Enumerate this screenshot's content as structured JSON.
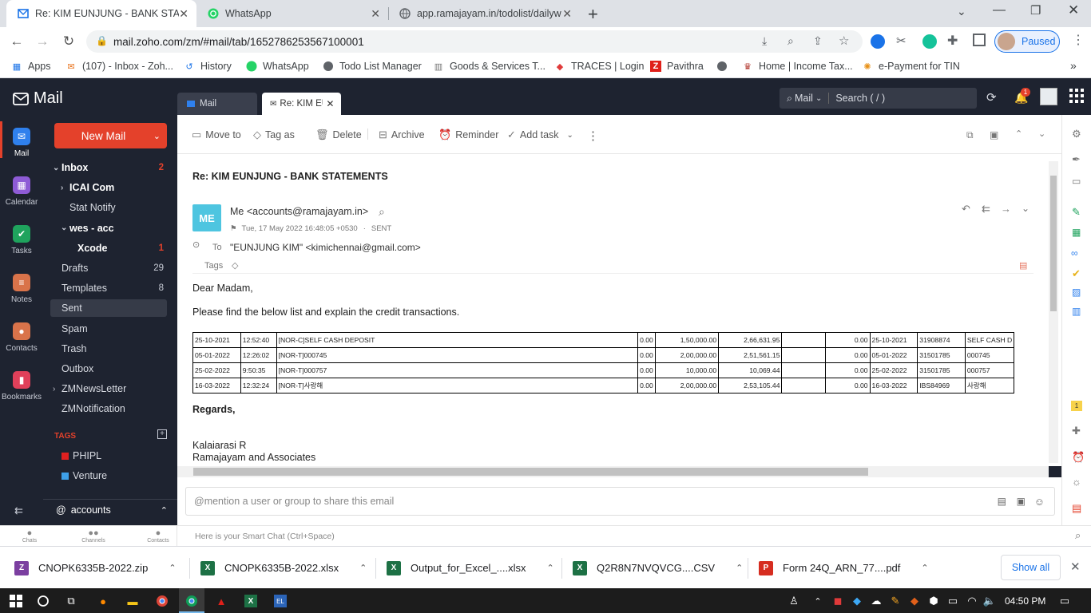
{
  "browser": {
    "tabs": [
      {
        "title": "Re: KIM EUNJUNG - BANK STATE",
        "active": true
      },
      {
        "title": "WhatsApp",
        "active": false
      },
      {
        "title": "app.ramajayam.in/todolist/dailyw",
        "active": false
      }
    ],
    "new_tab": "+",
    "url": "mail.zoho.com/zm/#mail/tab/1652786253567100001",
    "profile_status": "Paused",
    "bookmarks": [
      "Apps",
      "(107) - Inbox - Zoh...",
      "History",
      "WhatsApp",
      "Todo List Manager",
      "Goods & Services T...",
      "TRACES | Login",
      "Pavithra",
      "",
      "Home | Income Tax...",
      "e-Payment for TIN"
    ],
    "bookmarks_more": "»"
  },
  "zoho": {
    "app_title": "Mail",
    "rail": [
      {
        "label": "Mail",
        "color": "#2f80ed",
        "glyph": "✉"
      },
      {
        "label": "Calendar",
        "color": "#8e5bd6",
        "glyph": "▦"
      },
      {
        "label": "Tasks",
        "color": "#1fa35d",
        "glyph": "✔"
      },
      {
        "label": "Notes",
        "color": "#d9734a",
        "glyph": "≡"
      },
      {
        "label": "Contacts",
        "color": "#d9734a",
        "glyph": "●"
      },
      {
        "label": "Bookmarks",
        "color": "#e0405a",
        "glyph": "▮"
      }
    ],
    "new_mail": "New Mail",
    "folders": [
      {
        "label": "Inbox",
        "count": "2",
        "bold": true,
        "indent": 0,
        "toggle": "⌄"
      },
      {
        "label": "ICAI Com",
        "count": "",
        "bold": true,
        "indent": 1,
        "toggle": "›"
      },
      {
        "label": "Stat Notify",
        "count": "",
        "bold": false,
        "indent": 1,
        "toggle": ""
      },
      {
        "label": "wes - acc",
        "count": "",
        "bold": true,
        "indent": 1,
        "toggle": "⌄"
      },
      {
        "label": "Xcode",
        "count": "1",
        "bold": true,
        "indent": 2,
        "toggle": ""
      },
      {
        "label": "Drafts",
        "count": "29",
        "bold": false,
        "indent": 0,
        "toggle": ""
      },
      {
        "label": "Templates",
        "count": "8",
        "bold": false,
        "indent": 0,
        "toggle": ""
      },
      {
        "label": "Sent",
        "count": "",
        "bold": false,
        "indent": 0,
        "toggle": "",
        "selected": true
      },
      {
        "label": "Spam",
        "count": "",
        "bold": false,
        "indent": 0,
        "toggle": ""
      },
      {
        "label": "Trash",
        "count": "",
        "bold": false,
        "indent": 0,
        "toggle": ""
      },
      {
        "label": "Outbox",
        "count": "",
        "bold": false,
        "indent": 0,
        "toggle": ""
      },
      {
        "label": "ZMNewsLetter",
        "count": "",
        "bold": false,
        "indent": 0,
        "toggle": "›"
      },
      {
        "label": "ZMNotification",
        "count": "",
        "bold": false,
        "indent": 0,
        "toggle": ""
      }
    ],
    "tags_heading": "TAGS",
    "tags": [
      {
        "label": "PHIPL",
        "color": "#e02020"
      },
      {
        "label": "Venture",
        "color": "#3ea0e8"
      }
    ],
    "account": "accounts",
    "tabs": [
      "Mail",
      "Re: KIM EU"
    ],
    "search_scope": "Mail",
    "search_placeholder": "Search ( / )",
    "notif_count": "1",
    "toolbar": [
      "Move to",
      "Tag as",
      "Delete",
      "Archive",
      "Reminder",
      "Add task"
    ],
    "more": "⋮",
    "email": {
      "subject": "Re: KIM EUNJUNG - BANK STATEMENTS",
      "avatar": "ME",
      "from": "Me <accounts@ramajayam.in>",
      "date": "Tue, 17 May 2022 16:48:05 +0530",
      "status": "SENT",
      "to_label": "To",
      "to": "\"EUNJUNG KIM\" <kimichennai@gmail.com>",
      "tags_label": "Tags",
      "greeting": "Dear Madam,",
      "body": "Please find the below list and explain the credit transactions.",
      "table": [
        [
          "25-10-2021",
          "12:52:40",
          "[NOR-C]SELF CASH DEPOSIT",
          "",
          "0.00",
          "1,50,000.00",
          "2,66,631.95",
          "",
          "0.00",
          "25-10-2021",
          "31908874",
          "SELF CASH D"
        ],
        [
          "05-01-2022",
          "12:26:02",
          "[NOR-T]000745",
          "",
          "0.00",
          "2,00,000.00",
          "2,51,561.15",
          "",
          "0.00",
          "05-01-2022",
          "31501785",
          "000745"
        ],
        [
          "25-02-2022",
          "9:50:35",
          "[NOR-T]000757",
          "",
          "0.00",
          "10,000.00",
          "10,069.44",
          "",
          "0.00",
          "25-02-2022",
          "31501785",
          "000757"
        ],
        [
          "16-03-2022",
          "12:32:24",
          "[NOR-T]사랑해",
          "",
          "0.00",
          "2,00,000.00",
          "2,53,105.44",
          "",
          "0.00",
          "16-03-2022",
          "IBS84969",
          "사랑해"
        ]
      ],
      "regards": "Regards,",
      "sig_name": "Kalaiarasi R",
      "sig_company": "Ramajayam and Associates"
    },
    "mention_placeholder": "@mention a user or group to share this email",
    "bottom_tabs": [
      "Chats",
      "Channels",
      "Contacts"
    ],
    "smart_chat_placeholder": "Here is your Smart Chat (Ctrl+Space)",
    "right_badge": "1"
  },
  "downloads": {
    "items": [
      {
        "name": "CNOPK6335B-2022.zip",
        "color": "#7b3fa0",
        "glyph": "Z"
      },
      {
        "name": "CNOPK6335B-2022.xlsx",
        "color": "#1d7145",
        "glyph": "X"
      },
      {
        "name": "Output_for_Excel_....xlsx",
        "color": "#1d7145",
        "glyph": "X"
      },
      {
        "name": "Q2R8N7NVQVCG....CSV",
        "color": "#1d7145",
        "glyph": "X"
      },
      {
        "name": "Form 24Q_ARN_77....pdf",
        "color": "#d62d20",
        "glyph": "P"
      }
    ],
    "show_all": "Show all",
    "close": "✕"
  },
  "taskbar": {
    "time": "04:50 PM"
  }
}
